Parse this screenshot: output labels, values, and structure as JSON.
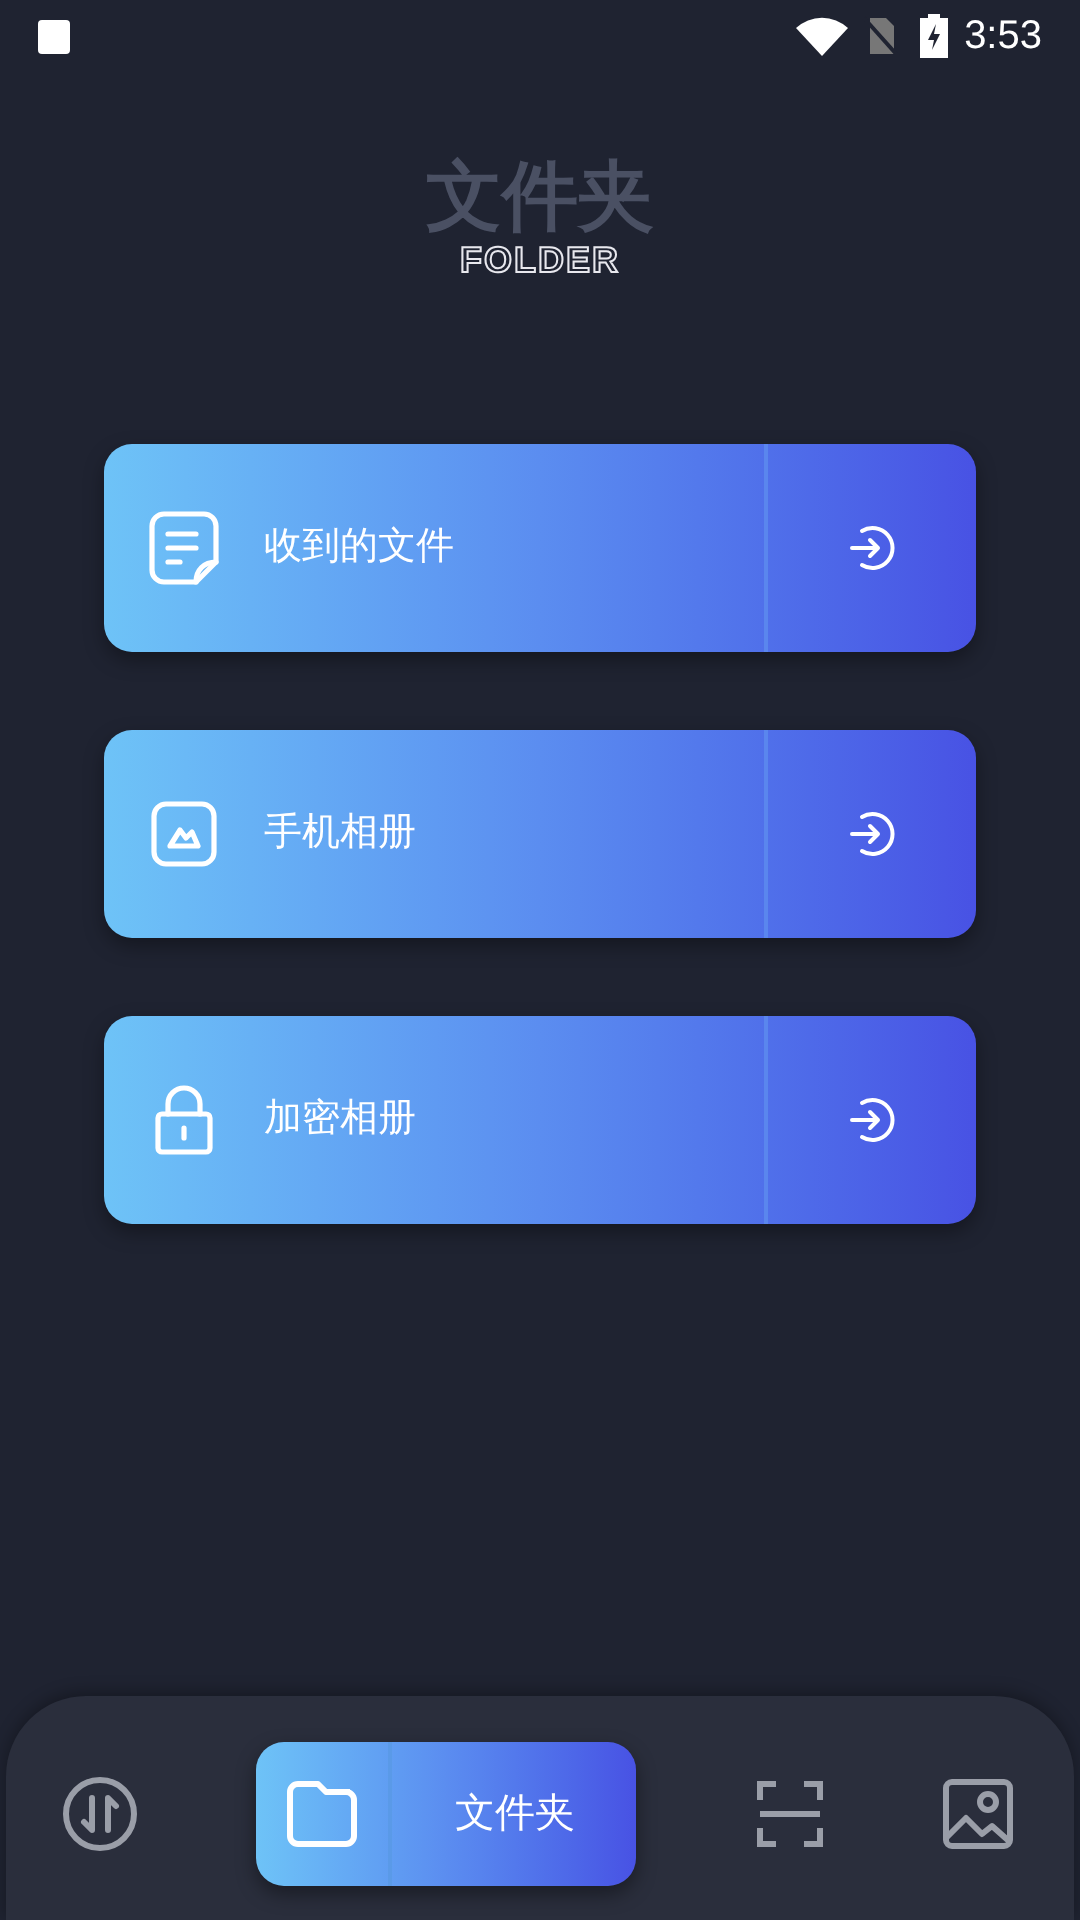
{
  "status_bar": {
    "time": "3:53"
  },
  "header": {
    "title": "文件夹",
    "subtitle": "FOLDER"
  },
  "entries": [
    {
      "kind": "document",
      "label": "收到的文件"
    },
    {
      "kind": "image",
      "label": "手机相册"
    },
    {
      "kind": "lock",
      "label": "加密相册"
    }
  ],
  "nav": [
    {
      "kind": "transfer",
      "selected": false
    },
    {
      "kind": "folder",
      "label": "文件夹",
      "selected": true
    },
    {
      "kind": "scan",
      "selected": false
    },
    {
      "kind": "gallery",
      "selected": false
    }
  ]
}
